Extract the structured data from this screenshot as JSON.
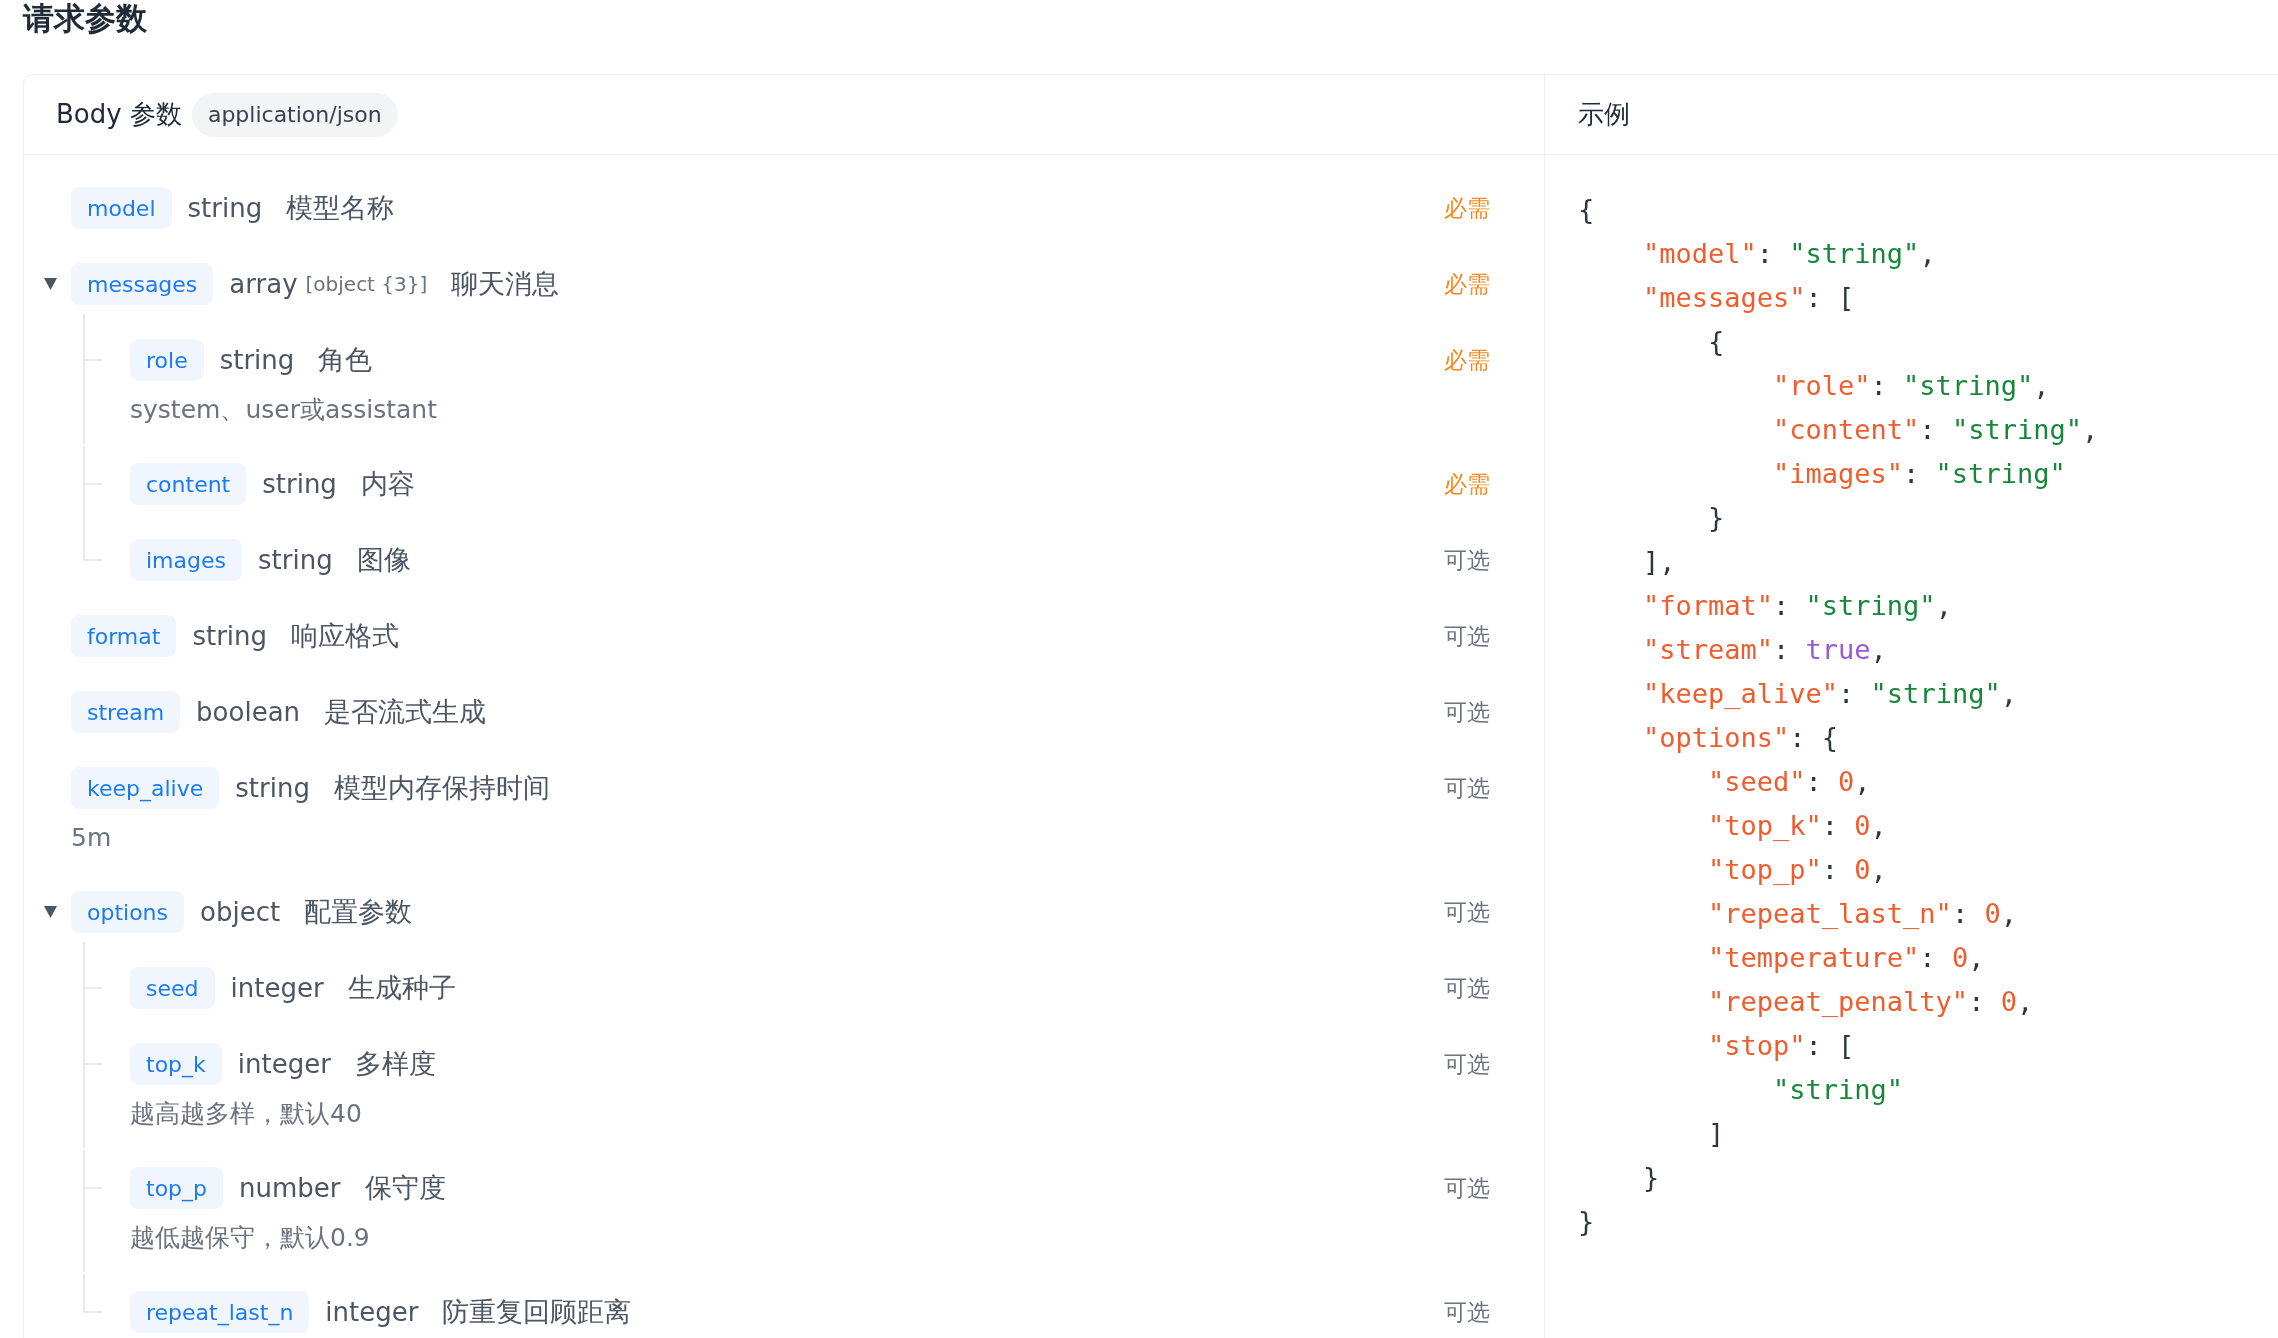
{
  "section_title": "请求参数",
  "body_params": {
    "heading": "Body 参数",
    "content_type": "application/json",
    "params": [
      {
        "name": "model",
        "type": "string",
        "title": "模型名称",
        "required": true,
        "requirement": "必需"
      },
      {
        "name": "messages",
        "type": "array",
        "type_detail": "[object {3}]",
        "title": "聊天消息",
        "required": true,
        "requirement": "必需",
        "expanded": true,
        "children": [
          {
            "name": "role",
            "type": "string",
            "title": "角色",
            "required": true,
            "requirement": "必需",
            "description": "system、user或assistant"
          },
          {
            "name": "content",
            "type": "string",
            "title": "内容",
            "required": true,
            "requirement": "必需"
          },
          {
            "name": "images",
            "type": "string",
            "title": "图像",
            "required": false,
            "requirement": "可选"
          }
        ]
      },
      {
        "name": "format",
        "type": "string",
        "title": "响应格式",
        "required": false,
        "requirement": "可选"
      },
      {
        "name": "stream",
        "type": "boolean",
        "title": "是否流式生成",
        "required": false,
        "requirement": "可选"
      },
      {
        "name": "keep_alive",
        "type": "string",
        "title": "模型内存保持时间",
        "required": false,
        "requirement": "可选",
        "description": "5m"
      },
      {
        "name": "options",
        "type": "object",
        "title": "配置参数",
        "required": false,
        "requirement": "可选",
        "expanded": true,
        "children": [
          {
            "name": "seed",
            "type": "integer",
            "title": "生成种子",
            "required": false,
            "requirement": "可选"
          },
          {
            "name": "top_k",
            "type": "integer",
            "title": "多样度",
            "required": false,
            "requirement": "可选",
            "description": "越高越多样，默认40"
          },
          {
            "name": "top_p",
            "type": "number",
            "title": "保守度",
            "required": false,
            "requirement": "可选",
            "description": "越低越保守，默认0.9"
          },
          {
            "name": "repeat_last_n",
            "type": "integer",
            "title": "防重复回顾距离",
            "required": false,
            "requirement": "可选"
          }
        ]
      }
    ]
  },
  "example": {
    "heading": "示例",
    "code": [
      {
        "tokens": [
          {
            "kind": "punct",
            "text": "{"
          }
        ],
        "children": [
          {
            "tokens": [
              {
                "kind": "key",
                "text": "\"model\""
              },
              {
                "kind": "punct",
                "text": ": "
              },
              {
                "kind": "string",
                "text": "\"string\""
              },
              {
                "kind": "punct",
                "text": ","
              }
            ]
          },
          {
            "tokens": [
              {
                "kind": "key",
                "text": "\"messages\""
              },
              {
                "kind": "punct",
                "text": ": ["
              }
            ],
            "children": [
              {
                "tokens": [
                  {
                    "kind": "punct",
                    "text": "{"
                  }
                ],
                "children": [
                  {
                    "tokens": [
                      {
                        "kind": "key",
                        "text": "\"role\""
                      },
                      {
                        "kind": "punct",
                        "text": ": "
                      },
                      {
                        "kind": "string",
                        "text": "\"string\""
                      },
                      {
                        "kind": "punct",
                        "text": ","
                      }
                    ]
                  },
                  {
                    "tokens": [
                      {
                        "kind": "key",
                        "text": "\"content\""
                      },
                      {
                        "kind": "punct",
                        "text": ": "
                      },
                      {
                        "kind": "string",
                        "text": "\"string\""
                      },
                      {
                        "kind": "punct",
                        "text": ","
                      }
                    ]
                  },
                  {
                    "tokens": [
                      {
                        "kind": "key",
                        "text": "\"images\""
                      },
                      {
                        "kind": "punct",
                        "text": ": "
                      },
                      {
                        "kind": "string",
                        "text": "\"string\""
                      }
                    ]
                  }
                ]
              },
              {
                "tokens": [
                  {
                    "kind": "punct",
                    "text": "}"
                  }
                ]
              }
            ]
          },
          {
            "tokens": [
              {
                "kind": "punct",
                "text": "],"
              }
            ]
          },
          {
            "tokens": [
              {
                "kind": "key",
                "text": "\"format\""
              },
              {
                "kind": "punct",
                "text": ": "
              },
              {
                "kind": "string",
                "text": "\"string\""
              },
              {
                "kind": "punct",
                "text": ","
              }
            ]
          },
          {
            "tokens": [
              {
                "kind": "key",
                "text": "\"stream\""
              },
              {
                "kind": "punct",
                "text": ": "
              },
              {
                "kind": "boolean",
                "text": "true"
              },
              {
                "kind": "punct",
                "text": ","
              }
            ]
          },
          {
            "tokens": [
              {
                "kind": "key",
                "text": "\"keep_alive\""
              },
              {
                "kind": "punct",
                "text": ": "
              },
              {
                "kind": "string",
                "text": "\"string\""
              },
              {
                "kind": "punct",
                "text": ","
              }
            ]
          },
          {
            "tokens": [
              {
                "kind": "key",
                "text": "\"options\""
              },
              {
                "kind": "punct",
                "text": ": {"
              }
            ],
            "children": [
              {
                "tokens": [
                  {
                    "kind": "key",
                    "text": "\"seed\""
                  },
                  {
                    "kind": "punct",
                    "text": ": "
                  },
                  {
                    "kind": "number",
                    "text": "0"
                  },
                  {
                    "kind": "punct",
                    "text": ","
                  }
                ]
              },
              {
                "tokens": [
                  {
                    "kind": "key",
                    "text": "\"top_k\""
                  },
                  {
                    "kind": "punct",
                    "text": ": "
                  },
                  {
                    "kind": "number",
                    "text": "0"
                  },
                  {
                    "kind": "punct",
                    "text": ","
                  }
                ]
              },
              {
                "tokens": [
                  {
                    "kind": "key",
                    "text": "\"top_p\""
                  },
                  {
                    "kind": "punct",
                    "text": ": "
                  },
                  {
                    "kind": "number",
                    "text": "0"
                  },
                  {
                    "kind": "punct",
                    "text": ","
                  }
                ]
              },
              {
                "tokens": [
                  {
                    "kind": "key",
                    "text": "\"repeat_last_n\""
                  },
                  {
                    "kind": "punct",
                    "text": ": "
                  },
                  {
                    "kind": "number",
                    "text": "0"
                  },
                  {
                    "kind": "punct",
                    "text": ","
                  }
                ]
              },
              {
                "tokens": [
                  {
                    "kind": "key",
                    "text": "\"temperature\""
                  },
                  {
                    "kind": "punct",
                    "text": ": "
                  },
                  {
                    "kind": "number",
                    "text": "0"
                  },
                  {
                    "kind": "punct",
                    "text": ","
                  }
                ]
              },
              {
                "tokens": [
                  {
                    "kind": "key",
                    "text": "\"repeat_penalty\""
                  },
                  {
                    "kind": "punct",
                    "text": ": "
                  },
                  {
                    "kind": "number",
                    "text": "0"
                  },
                  {
                    "kind": "punct",
                    "text": ","
                  }
                ]
              },
              {
                "tokens": [
                  {
                    "kind": "key",
                    "text": "\"stop\""
                  },
                  {
                    "kind": "punct",
                    "text": ": ["
                  }
                ],
                "children": [
                  {
                    "tokens": [
                      {
                        "kind": "string",
                        "text": "\"string\""
                      }
                    ]
                  }
                ]
              },
              {
                "tokens": [
                  {
                    "kind": "punct",
                    "text": "]"
                  }
                ]
              }
            ]
          },
          {
            "tokens": [
              {
                "kind": "punct",
                "text": "}"
              }
            ]
          }
        ]
      },
      {
        "tokens": [
          {
            "kind": "punct",
            "text": "}"
          }
        ]
      }
    ]
  }
}
